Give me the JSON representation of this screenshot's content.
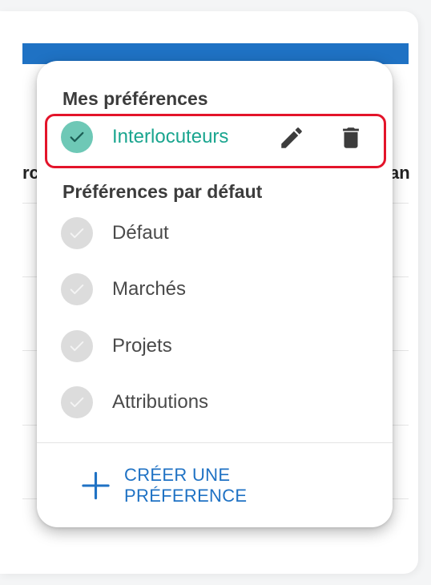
{
  "background_table": {
    "left_fragment": "rc",
    "right_fragment": "an"
  },
  "menu": {
    "my_prefs_title": "Mes préférences",
    "my_prefs": [
      {
        "label": "Interlocuteurs",
        "selected": true
      }
    ],
    "default_prefs_title": "Préférences par défaut",
    "default_prefs": [
      {
        "label": "Défaut"
      },
      {
        "label": "Marchés"
      },
      {
        "label": "Projets"
      },
      {
        "label": "Attributions"
      }
    ],
    "create_label": "CRÉER UNE PRÉFERENCE"
  },
  "icons": {
    "edit": "pencil-icon",
    "delete": "trash-icon",
    "create": "plus-icon",
    "check": "check-icon"
  },
  "colors": {
    "accent_blue": "#1f72c4",
    "selected_teal": "#1aa58f",
    "selected_check_bg": "#6ec8b6",
    "highlight_red": "#e3142a"
  }
}
